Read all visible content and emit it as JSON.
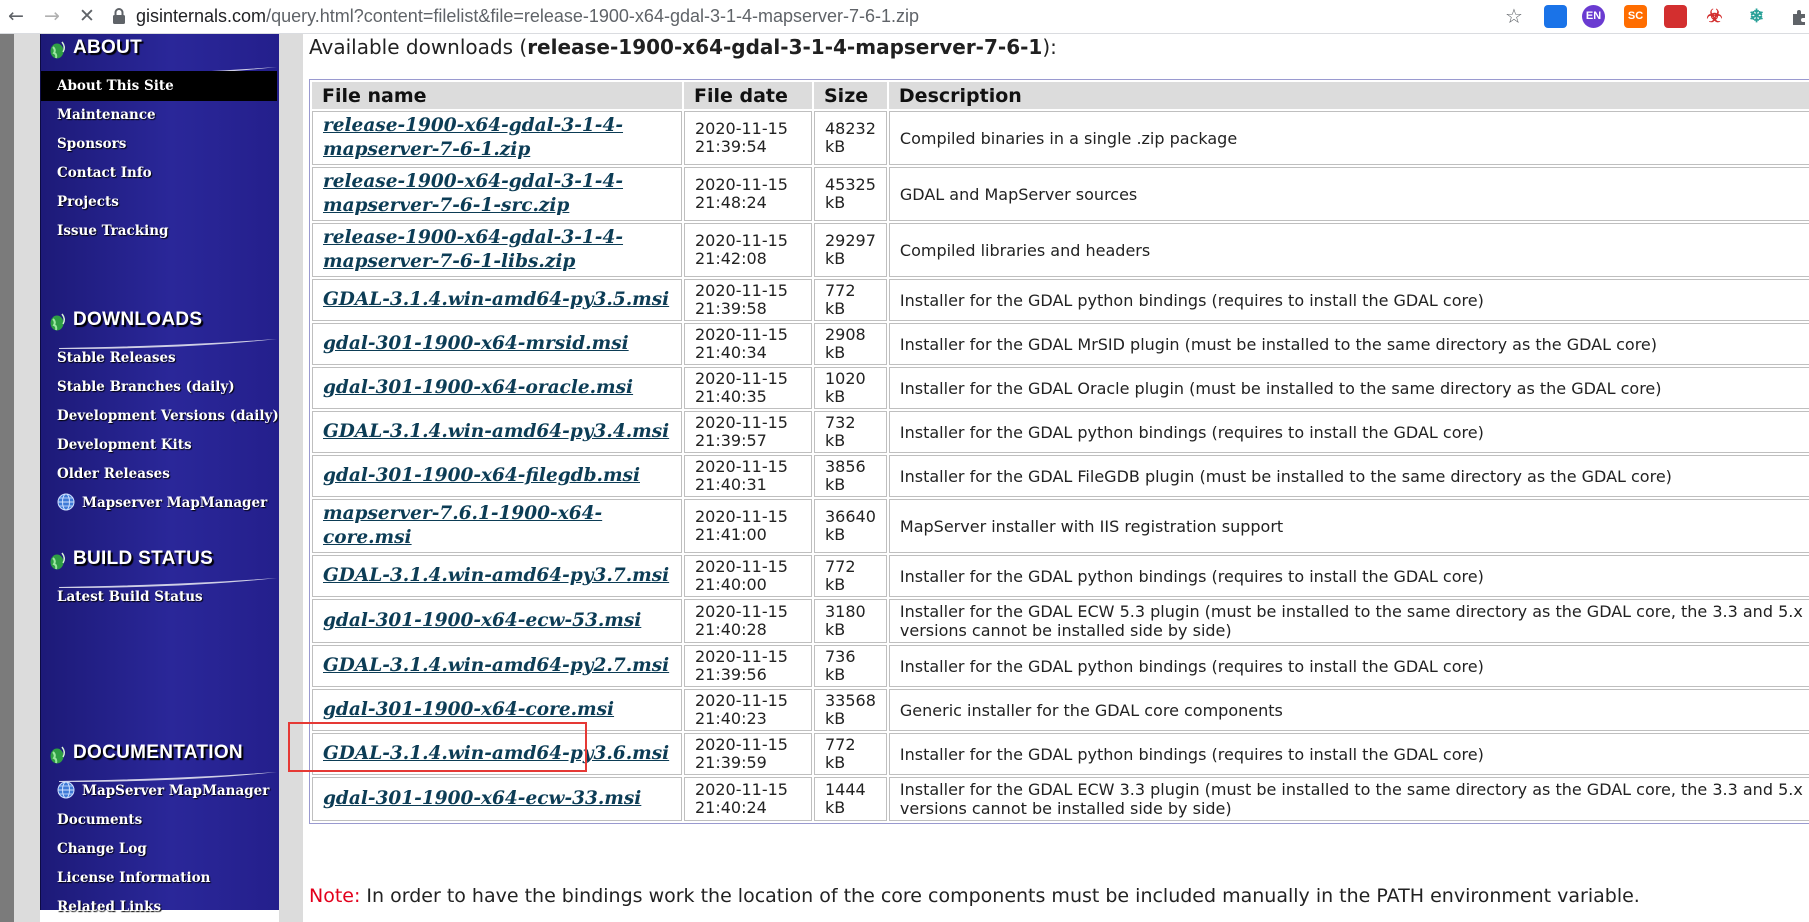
{
  "browser": {
    "url_host": "gisinternals.com",
    "url_rest": "/query.html?content=filelist&file=release-1900-x64-gdal-3-1-4-mapserver-7-6-1.zip",
    "extensions": [
      {
        "name": "extension-blue",
        "label": "",
        "color": "#1a73e8"
      },
      {
        "name": "extension-en",
        "label": "EN",
        "color": "#6a3bd1"
      },
      {
        "name": "extension-sc",
        "label": "SC",
        "color": "#ff6d00"
      },
      {
        "name": "extension-red",
        "label": "",
        "color": "#d32f2f"
      },
      {
        "name": "extension-cart",
        "label": "",
        "color": "#ffffff"
      },
      {
        "name": "extension-leaf",
        "label": "",
        "color": "#ffffff"
      }
    ]
  },
  "sidebar": {
    "sections": [
      {
        "title": "ABOUT",
        "items": [
          {
            "label": "About This Site",
            "active": true,
            "icon": false
          },
          {
            "label": "Maintenance",
            "active": false,
            "icon": false
          },
          {
            "label": "Sponsors",
            "active": false,
            "icon": false
          },
          {
            "label": "Contact Info",
            "active": false,
            "icon": false
          },
          {
            "label": "Projects",
            "active": false,
            "icon": false
          },
          {
            "label": "Issue Tracking",
            "active": false,
            "icon": false
          }
        ]
      },
      {
        "title": "DOWNLOADS",
        "items": [
          {
            "label": "Stable Releases",
            "active": false,
            "icon": false
          },
          {
            "label": "Stable Branches (daily)",
            "active": false,
            "icon": false
          },
          {
            "label": "Development Versions (daily)",
            "active": false,
            "icon": false
          },
          {
            "label": "Development Kits",
            "active": false,
            "icon": false
          },
          {
            "label": "Older Releases",
            "active": false,
            "icon": false
          },
          {
            "label": "Mapserver MapManager",
            "active": false,
            "icon": true
          }
        ]
      },
      {
        "title": "BUILD STATUS",
        "items": [
          {
            "label": "Latest Build Status",
            "active": false,
            "icon": false
          }
        ]
      },
      {
        "title": "DOCUMENTATION",
        "items": [
          {
            "label": "MapServer MapManager",
            "active": false,
            "icon": true
          },
          {
            "label": "Documents",
            "active": false,
            "icon": false
          },
          {
            "label": "Change Log",
            "active": false,
            "icon": false
          },
          {
            "label": "License Information",
            "active": false,
            "icon": false
          },
          {
            "label": "Related Links",
            "active": false,
            "icon": false
          }
        ]
      }
    ]
  },
  "main": {
    "heading_prefix": "Available downloads (",
    "heading_file": "release-1900-x64-gdal-3-1-4-mapserver-7-6-1",
    "heading_suffix": "):",
    "columns": [
      "File name",
      "File date",
      "Size",
      "Description"
    ],
    "rows": [
      {
        "name": "release-1900-x64-gdal-3-1-4-mapserver-7-6-1.zip",
        "date": "2020-11-15 21:39:54",
        "size": "48232 kB",
        "desc": "Compiled binaries in a single .zip package"
      },
      {
        "name": "release-1900-x64-gdal-3-1-4-mapserver-7-6-1-src.zip",
        "date": "2020-11-15 21:48:24",
        "size": "45325 kB",
        "desc": "GDAL and MapServer sources"
      },
      {
        "name": "release-1900-x64-gdal-3-1-4-mapserver-7-6-1-libs.zip",
        "date": "2020-11-15 21:42:08",
        "size": "29297 kB",
        "desc": "Compiled libraries and headers"
      },
      {
        "name": "GDAL-3.1.4.win-amd64-py3.5.msi",
        "date": "2020-11-15 21:39:58",
        "size": "772 kB",
        "desc": "Installer for the GDAL python bindings (requires to install the GDAL core)"
      },
      {
        "name": "gdal-301-1900-x64-mrsid.msi",
        "date": "2020-11-15 21:40:34",
        "size": "2908 kB",
        "desc": "Installer for the GDAL MrSID plugin (must be installed to the same directory as the GDAL core)"
      },
      {
        "name": "gdal-301-1900-x64-oracle.msi",
        "date": "2020-11-15 21:40:35",
        "size": "1020 kB",
        "desc": "Installer for the GDAL Oracle plugin (must be installed to the same directory as the GDAL core)"
      },
      {
        "name": "GDAL-3.1.4.win-amd64-py3.4.msi",
        "date": "2020-11-15 21:39:57",
        "size": "732 kB",
        "desc": "Installer for the GDAL python bindings (requires to install the GDAL core)"
      },
      {
        "name": "gdal-301-1900-x64-filegdb.msi",
        "date": "2020-11-15 21:40:31",
        "size": "3856 kB",
        "desc": "Installer for the GDAL FileGDB plugin (must be installed to the same directory as the GDAL core)"
      },
      {
        "name": "mapserver-7.6.1-1900-x64-core.msi",
        "date": "2020-11-15 21:41:00",
        "size": "36640 kB",
        "desc": "MapServer installer with IIS registration support"
      },
      {
        "name": "GDAL-3.1.4.win-amd64-py3.7.msi",
        "date": "2020-11-15 21:40:00",
        "size": "772 kB",
        "desc": "Installer for the GDAL python bindings (requires to install the GDAL core)"
      },
      {
        "name": "gdal-301-1900-x64-ecw-53.msi",
        "date": "2020-11-15 21:40:28",
        "size": "3180 kB",
        "desc": "Installer for the GDAL ECW 5.3 plugin (must be installed to the same directory as the GDAL core, the 3.3 and 5.x versions cannot be installed side by side)"
      },
      {
        "name": "GDAL-3.1.4.win-amd64-py2.7.msi",
        "date": "2020-11-15 21:39:56",
        "size": "736 kB",
        "desc": "Installer for the GDAL python bindings (requires to install the GDAL core)"
      },
      {
        "name": "gdal-301-1900-x64-core.msi",
        "date": "2020-11-15 21:40:23",
        "size": "33568 kB",
        "desc": "Generic installer for the GDAL core components"
      },
      {
        "name": "GDAL-3.1.4.win-amd64-py3.6.msi",
        "date": "2020-11-15 21:39:59",
        "size": "772 kB",
        "desc": "Installer for the GDAL python bindings (requires to install the GDAL core)"
      },
      {
        "name": "gdal-301-1900-x64-ecw-33.msi",
        "date": "2020-11-15 21:40:24",
        "size": "1444 kB",
        "desc": "Installer for the GDAL ECW 3.3 plugin (must be installed to the same directory as the GDAL core, the 3.3 and 5.x versions cannot be installed side by side)"
      }
    ],
    "note_label": "Note:",
    "note_text": " In order to have the bindings work the location of the core components must be included manually in the PATH environment variable."
  }
}
